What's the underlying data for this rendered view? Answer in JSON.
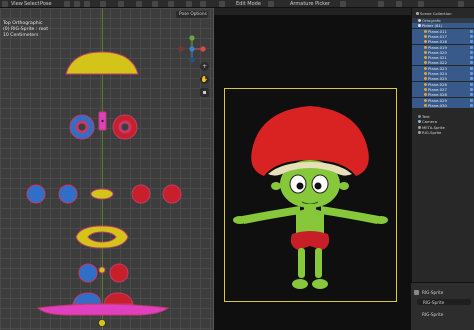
{
  "menu": {
    "view": "View",
    "select": "Select",
    "pose": "Pose",
    "edit_mode": "Edit Mode",
    "armature_picker": "Armature Picker"
  },
  "left_viewport": {
    "overlay_view": "Top Orthographic",
    "overlay_object": "(0) RIG-Sprite : root",
    "overlay_scale": "10 Centimeters",
    "pose_options": "Pose Options",
    "colors": {
      "yellow": "#d4c41a",
      "blue": "#2f6fc8",
      "red": "#c8202a",
      "magenta": "#e040c0",
      "outline": "#c23a6a",
      "grid": "#3d3d3d"
    },
    "gizmo_axes": [
      "X",
      "Y",
      "Z"
    ]
  },
  "center_viewport": {
    "frame_color": "#d8c83a",
    "character_colors": {
      "cap": "#d92222",
      "skin": "#86c83a",
      "shorts": "#c81e28"
    }
  },
  "outliner": {
    "rows": [
      {
        "label": "Scene Collection",
        "kind": "scene"
      },
      {
        "label": "Ortografic",
        "kind": "collection"
      },
      {
        "label": "Picker (61)",
        "kind": "selected-header"
      },
      {
        "label": "Plane.011",
        "kind": "plane"
      },
      {
        "label": "Plane.017",
        "kind": "plane"
      },
      {
        "label": "Plane.018",
        "kind": "plane"
      },
      {
        "label": "Plane.019",
        "kind": "plane"
      },
      {
        "label": "Plane.020",
        "kind": "plane"
      },
      {
        "label": "Plane.021",
        "kind": "plane"
      },
      {
        "label": "Plane.022",
        "kind": "plane"
      },
      {
        "label": "Plane.023",
        "kind": "plane"
      },
      {
        "label": "Plane.024",
        "kind": "plane"
      },
      {
        "label": "Plane.025",
        "kind": "plane"
      },
      {
        "label": "Plane.026",
        "kind": "plane"
      },
      {
        "label": "Plane.027",
        "kind": "plane"
      },
      {
        "label": "Plane.028",
        "kind": "plane"
      },
      {
        "label": "Plane.029",
        "kind": "plane"
      },
      {
        "label": "Plane.030",
        "kind": "plane"
      },
      {
        "label": "Text",
        "kind": "text"
      },
      {
        "label": "Camera",
        "kind": "camera"
      },
      {
        "label": "META-Sprite",
        "kind": "meta"
      },
      {
        "label": "RIG-Sprite",
        "kind": "rig"
      }
    ],
    "properties": {
      "rig_name": "RIG-Sprite",
      "rig_name_field": "RIG-Sprite",
      "armature_name": "RIG-Sprite"
    }
  }
}
